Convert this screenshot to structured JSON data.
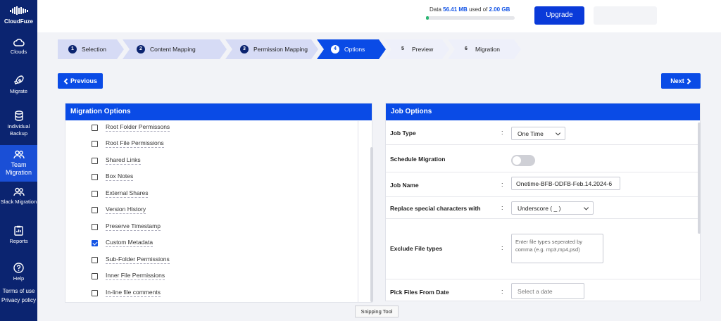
{
  "app": {
    "name": "CloudFuze"
  },
  "sidebar": {
    "items": [
      {
        "label": "Clouds",
        "icon": "cloud-icon"
      },
      {
        "label": "Migrate",
        "icon": "rocket-icon"
      },
      {
        "label": "Individual Backup",
        "icon": "database-icon"
      },
      {
        "label": "Team Migration",
        "icon": "users-icon",
        "active": true
      },
      {
        "label": "Slack Migration",
        "icon": "users-icon"
      },
      {
        "label": "Reports",
        "icon": "report-icon"
      },
      {
        "label": "Help",
        "icon": "help-icon"
      }
    ],
    "links": {
      "terms": "Terms of use",
      "privacy": "Privacy policy"
    }
  },
  "topbar": {
    "data_prefix": "Data",
    "data_used": "56.41 MB",
    "data_mid": "used of",
    "data_total": "2.00 GB",
    "usage_fraction": 0.028,
    "upgrade_label": "Upgrade"
  },
  "steps": [
    {
      "num": "1",
      "label": "Selection",
      "state": "done"
    },
    {
      "num": "2",
      "label": "Content Mapping",
      "state": "done"
    },
    {
      "num": "3",
      "label": "Permission Mapping",
      "state": "done"
    },
    {
      "num": "4",
      "label": "Options",
      "state": "active"
    },
    {
      "num": "5",
      "label": "Preview",
      "state": "future"
    },
    {
      "num": "6",
      "label": "Migration",
      "state": "future"
    }
  ],
  "nav": {
    "previous": "Previous",
    "next": "Next"
  },
  "migration_options": {
    "title": "Migration Options",
    "items": [
      {
        "label": "Root Folder Permissons",
        "checked": false
      },
      {
        "label": "Root File Permissions",
        "checked": false
      },
      {
        "label": "Shared Links",
        "checked": false
      },
      {
        "label": "Box Notes",
        "checked": false
      },
      {
        "label": "External Shares",
        "checked": false
      },
      {
        "label": "Version History",
        "checked": false
      },
      {
        "label": "Preserve Timestamp",
        "checked": false
      },
      {
        "label": "Custom Metadata",
        "checked": true
      },
      {
        "label": "Sub-Folder Permissions",
        "checked": false
      },
      {
        "label": "Inner File Permissions",
        "checked": false
      },
      {
        "label": "In-line file comments",
        "checked": false
      }
    ]
  },
  "job_options": {
    "title": "Job Options",
    "colon": ":",
    "job_type": {
      "label": "Job Type",
      "value": "One Time"
    },
    "schedule": {
      "label": "Schedule Migration",
      "enabled": false
    },
    "job_name": {
      "label": "Job Name",
      "value": "Onetime-BFB-ODFB-Feb.14.2024-6"
    },
    "replace_chars": {
      "label": "Replace special characters with",
      "value": "Underscore ( _ )"
    },
    "exclude_types": {
      "label": "Exclude File types",
      "placeholder": "Enter file types seperated by comma (e.g. mp3,mp4,psd)"
    },
    "pick_date": {
      "label": "Pick Files From Date",
      "placeholder": "Select a date"
    }
  },
  "overlay": {
    "snipping_tool": "Snipping Tool"
  }
}
